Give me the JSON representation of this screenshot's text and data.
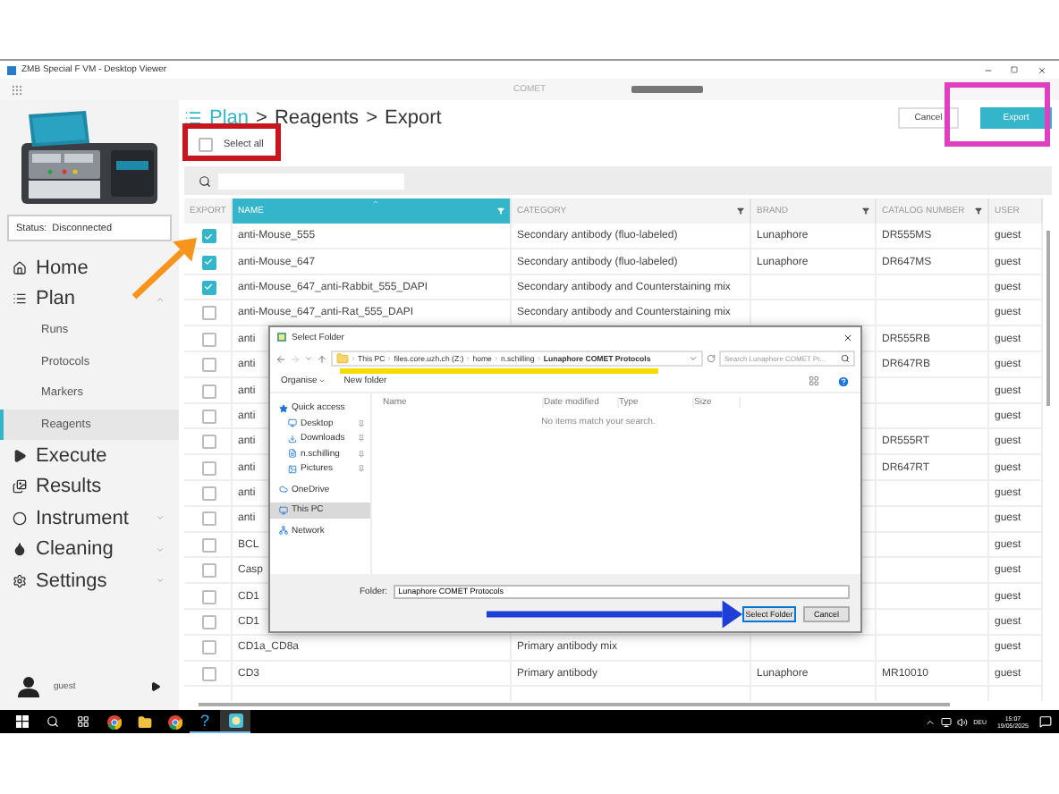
{
  "window": {
    "title": "ZMB Special F VM - Desktop Viewer"
  },
  "app_header": {
    "title": "COMET"
  },
  "sidebar": {
    "status": "Status:  Disconnected",
    "nav": [
      {
        "label": "Home",
        "selected": false
      },
      {
        "label": "Plan",
        "selected": false,
        "expanded": true,
        "children": [
          {
            "label": "Runs",
            "selected": false
          },
          {
            "label": "Protocols",
            "selected": false
          },
          {
            "label": "Markers",
            "selected": false
          },
          {
            "label": "Reagents",
            "selected": true
          }
        ]
      },
      {
        "label": "Execute",
        "selected": false
      },
      {
        "label": "Results",
        "selected": false
      },
      {
        "label": "Instrument",
        "selected": false,
        "expanded": false
      },
      {
        "label": "Cleaning",
        "selected": false,
        "expanded": false
      },
      {
        "label": "Settings",
        "selected": false,
        "expanded": false
      }
    ],
    "user": "guest"
  },
  "breadcrumb": [
    {
      "text": "Plan",
      "kind": "link"
    },
    {
      "text": ">",
      "kind": "sep"
    },
    {
      "text": "Reagents",
      "kind": "crumb"
    },
    {
      "text": ">",
      "kind": "sep"
    },
    {
      "text": "Export",
      "kind": "crumb"
    }
  ],
  "buttons": [
    {
      "label": "Cancel",
      "kind": "secondary"
    },
    {
      "label": "Export",
      "kind": "primary"
    }
  ],
  "select_all": {
    "label": "Select all",
    "checked": false
  },
  "table": {
    "columns": [
      {
        "label": "EXPORT",
        "sorted": false,
        "filter": false
      },
      {
        "label": "NAME",
        "sorted": true,
        "filter": true
      },
      {
        "label": "CATEGORY",
        "sorted": false,
        "filter": true
      },
      {
        "label": "BRAND",
        "sorted": false,
        "filter": true
      },
      {
        "label": "CATALOG NUMBER",
        "sorted": false,
        "filter": true
      },
      {
        "label": "USER",
        "sorted": false,
        "filter": false
      }
    ],
    "rows": [
      {
        "export": true,
        "name": "anti-Mouse_555",
        "category": "Secondary antibody (fluo-labeled)",
        "brand": "Lunaphore",
        "catalog_number": "DR555MS",
        "user": "guest"
      },
      {
        "export": true,
        "name": "anti-Mouse_647",
        "category": "Secondary antibody (fluo-labeled)",
        "brand": "Lunaphore",
        "catalog_number": "DR647MS",
        "user": "guest"
      },
      {
        "export": true,
        "name": "anti-Mouse_647_anti-Rabbit_555_DAPI",
        "category": "Secondary antibody and Counterstaining mix",
        "user": "guest"
      },
      {
        "export": false,
        "name": "anti-Mouse_647_anti-Rat_555_DAPI",
        "category": "Secondary antibody and Counterstaining mix",
        "user": "guest"
      },
      {
        "export": false,
        "name": "anti",
        "catalog_number": "DR555RB",
        "user": "guest"
      },
      {
        "export": false,
        "name": "anti",
        "catalog_number": "DR647RB",
        "user": "guest"
      },
      {
        "export": false,
        "name": "anti",
        "user": "guest"
      },
      {
        "export": false,
        "name": "anti",
        "user": "guest"
      },
      {
        "export": false,
        "name": "anti",
        "catalog_number": "DR555RT",
        "user": "guest"
      },
      {
        "export": false,
        "name": "anti",
        "catalog_number": "DR647RT",
        "user": "guest"
      },
      {
        "export": false,
        "name": "anti",
        "user": "guest"
      },
      {
        "export": false,
        "name": "anti",
        "user": "guest"
      },
      {
        "export": false,
        "name": "BCL",
        "user": "guest"
      },
      {
        "export": false,
        "name": "Casp",
        "user": "guest"
      },
      {
        "export": false,
        "name": "CD1",
        "user": "guest"
      },
      {
        "export": false,
        "name": "CD1",
        "user": "guest"
      },
      {
        "export": false,
        "name": "CD1a_CD8a",
        "category": "Primary antibody mix",
        "user": "guest"
      },
      {
        "export": false,
        "name": "CD3",
        "category": "Primary antibody",
        "brand": "Lunaphore",
        "catalog_number": "MR10010",
        "user": "guest"
      }
    ]
  },
  "dialog": {
    "title": "Select Folder",
    "path": [
      "This PC",
      "files.core.uzh.ch (Z:)",
      "home",
      "n.schilling",
      "Lunaphore COMET Protocols"
    ],
    "search": {
      "placeholder": "Search Lunaphore COMET Pr..."
    },
    "toolbar": [
      {
        "label": "Organise",
        "kind": "menu"
      },
      {
        "label": "New folder",
        "kind": "action"
      }
    ],
    "nav": [
      {
        "label": "Quick access",
        "selected": false,
        "children": [
          {
            "label": "Desktop",
            "pinned": true,
            "selected": false
          },
          {
            "label": "Downloads",
            "pinned": true,
            "selected": false
          },
          {
            "label": "n.schilling",
            "pinned": true,
            "selected": false
          },
          {
            "label": "Pictures",
            "pinned": true,
            "selected": false
          }
        ]
      },
      {
        "label": "OneDrive",
        "selected": false
      },
      {
        "label": "This PC",
        "selected": true
      },
      {
        "label": "Network",
        "selected": false
      }
    ],
    "columns": [
      "Name",
      "Date modified",
      "Type",
      "Size"
    ],
    "empty_message": "No items match your search.",
    "folder_label": "Folder:",
    "folder_value": "Lunaphore COMET Protocols",
    "buttons": [
      {
        "label": "Select Folder",
        "kind": "primary"
      },
      {
        "label": "Cancel",
        "kind": "secondary"
      }
    ]
  },
  "annotations": [
    {
      "kind": "frame",
      "color": "#c8161e"
    },
    {
      "kind": "frame",
      "color": "#e040c0"
    },
    {
      "kind": "arrow",
      "color": "#f7941d"
    },
    {
      "kind": "underline",
      "color": "#f5dc00"
    },
    {
      "kind": "arrow",
      "color": "#1d3fd6"
    }
  ],
  "taskbar": {
    "apps": [
      {
        "kind": "browser",
        "running": false,
        "active": false
      },
      {
        "kind": "folder",
        "running": false,
        "active": false
      },
      {
        "kind": "browser",
        "running": false,
        "active": false
      },
      {
        "kind": "help",
        "label": "?",
        "running": true,
        "active": false
      },
      {
        "kind": "comet",
        "running": true,
        "active": true
      }
    ],
    "language": "DEU",
    "time": "15:07",
    "date": "19/05/2025"
  }
}
